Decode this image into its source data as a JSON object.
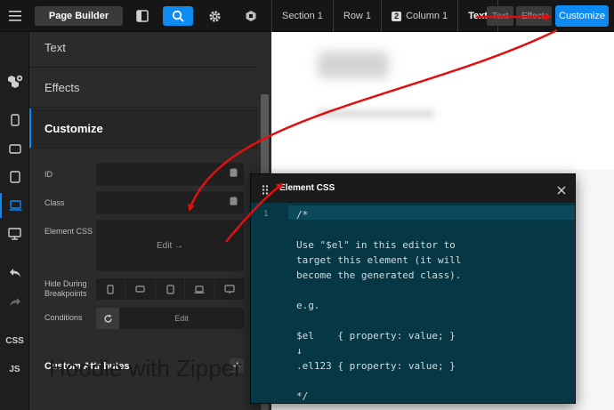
{
  "toolbar": {
    "page_builder_label": "Page Builder",
    "customize_label": "Customize",
    "tabs": [
      "Text",
      "Effects"
    ]
  },
  "breadcrumbs": [
    {
      "label": "Section 1"
    },
    {
      "label": "Row 1"
    },
    {
      "num": "2",
      "label": "Column 1"
    },
    {
      "label": "Text"
    }
  ],
  "rail": {
    "css_label": "CSS",
    "js_label": "JS"
  },
  "panel": {
    "sections": {
      "text": "Text",
      "effects": "Effects",
      "customize": "Customize"
    },
    "fields": {
      "id_label": "ID",
      "class_label": "Class",
      "element_css_label": "Element CSS",
      "element_css_edit": "Edit →",
      "hide_label_1": "Hide During",
      "hide_label_2": "Breakpoints",
      "conditions_label": "Conditions",
      "conditions_edit": "Edit"
    },
    "custom_attributes_label": "Custom Attributes"
  },
  "canvas": {
    "bottom_text": "Hoodie with Zipper"
  },
  "modal": {
    "title": "Element CSS",
    "line_number": "1",
    "code_lines": [
      "/*",
      "",
      "Use \"$el\" in this editor to",
      "target this element (it will",
      "become the generated class).",
      "",
      "e.g.",
      "",
      "$el    { property: value; }",
      "↓",
      ".el123 { property: value; }",
      "",
      "*/"
    ]
  },
  "colors": {
    "accent": "#0d8bf2",
    "annotation_arrow": "#e01010",
    "editor_bg": "#063744"
  }
}
